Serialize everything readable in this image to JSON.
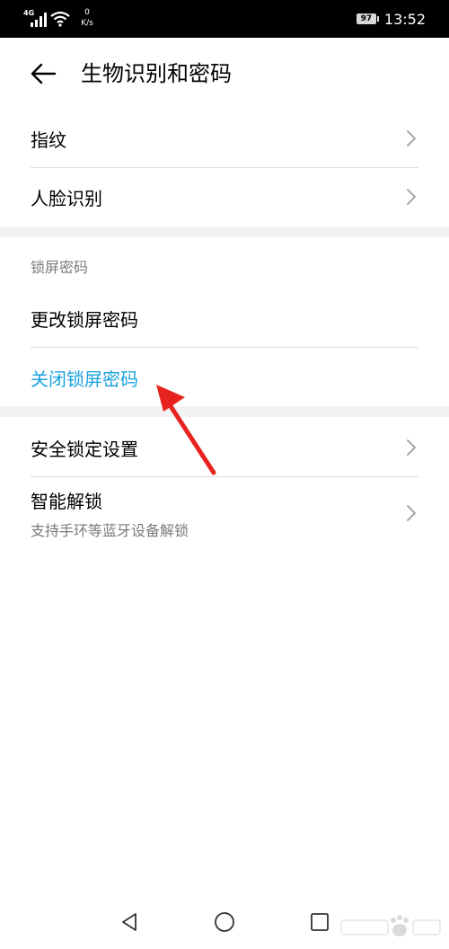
{
  "status_bar": {
    "network_type": "4G",
    "net_speed_value": "0",
    "net_speed_unit": "K/s",
    "battery_level": "97",
    "time": "13:52"
  },
  "header": {
    "title": "生物识别和密码"
  },
  "biometrics": {
    "fingerprint": "指纹",
    "face_recognition": "人脸识别"
  },
  "lock_screen": {
    "section_title": "锁屏密码",
    "change_password": "更改锁屏密码",
    "disable_password": "关闭锁屏密码"
  },
  "security": {
    "lock_settings": "安全锁定设置",
    "smart_unlock": "智能解锁",
    "smart_unlock_desc": "支持手环等蓝牙设备解锁"
  },
  "colors": {
    "accent": "#1aa3e0",
    "annotation_arrow": "#e8221f"
  },
  "icons": {
    "back": "arrow-left-icon",
    "chevron": "chevron-right-icon",
    "nav_back": "triangle-back-icon",
    "nav_home": "circle-home-icon",
    "nav_recent": "square-recent-icon"
  }
}
